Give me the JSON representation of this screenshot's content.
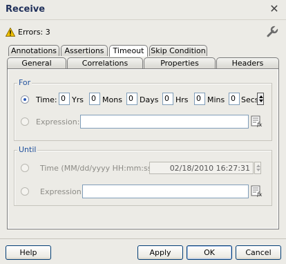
{
  "dialog": {
    "title": "Receive"
  },
  "errors": {
    "text": "Errors: 3"
  },
  "tabs": {
    "row_back": [
      "Annotations",
      "Assertions",
      "Timeout",
      "Skip Condition"
    ],
    "row_front": [
      "General",
      "Correlations",
      "Properties",
      "Headers"
    ],
    "active": "Timeout"
  },
  "for_group": {
    "label": "For",
    "time_option": {
      "label": "Time:",
      "selected": true,
      "fields": [
        {
          "value": "0",
          "unit": "Yrs"
        },
        {
          "value": "0",
          "unit": "Mons"
        },
        {
          "value": "0",
          "unit": "Days"
        },
        {
          "value": "0",
          "unit": "Hrs"
        },
        {
          "value": "0",
          "unit": "Mins"
        },
        {
          "value": "0",
          "unit": "Secs"
        }
      ]
    },
    "expression_option": {
      "label": "Expression:",
      "value": ""
    }
  },
  "until_group": {
    "label": "Until",
    "time_option": {
      "label": "Time (MM/dd/yyyy HH:mm:ss):",
      "value": "02/18/2010 16:27:31"
    },
    "expression_option": {
      "label": "Expression:",
      "value": ""
    }
  },
  "buttons": {
    "help": "Help",
    "apply": "Apply",
    "ok": "OK",
    "cancel": "Cancel"
  },
  "colors": {
    "group_label": "#1e4f9c",
    "title": "#1f2f5a",
    "warning": "#f2c200"
  }
}
